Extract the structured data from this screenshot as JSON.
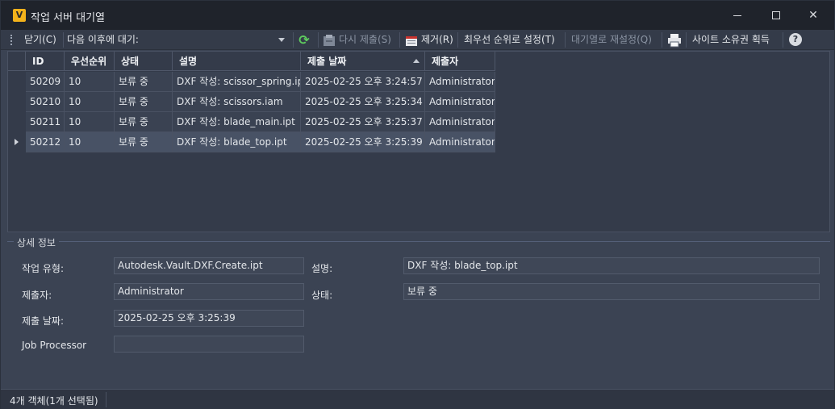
{
  "window": {
    "title": "작업 서버 대기열",
    "icon_letter": "V"
  },
  "toolbar": {
    "close_label": "닫기(C)",
    "wait_label": "다음 이후에 대기:",
    "resubmit_label": "다시 제출(S)",
    "remove_label": "제거(R)",
    "top_priority_label": "최우선 순위로 설정(T)",
    "requeue_label": "대기열로 재설정(Q)",
    "take_ownership_label": "사이트 소유권 획득"
  },
  "grid": {
    "columns": [
      "ID",
      "우선순위",
      "상태",
      "설명",
      "제출 날짜",
      "제출자"
    ],
    "sort_column": "제출 날짜",
    "rows": [
      {
        "id": "50209",
        "priority": "10",
        "status": "보류 중",
        "description": "DXF 작성: scissor_spring.ipt",
        "submitted": "2025-02-25 오후 3:24:57",
        "submitter": "Administrator",
        "selected": false
      },
      {
        "id": "50210",
        "priority": "10",
        "status": "보류 중",
        "description": "DXF 작성: scissors.iam",
        "submitted": "2025-02-25 오후 3:25:34",
        "submitter": "Administrator",
        "selected": false
      },
      {
        "id": "50211",
        "priority": "10",
        "status": "보류 중",
        "description": "DXF 작성: blade_main.ipt",
        "submitted": "2025-02-25 오후 3:25:37",
        "submitter": "Administrator",
        "selected": false
      },
      {
        "id": "50212",
        "priority": "10",
        "status": "보류 중",
        "description": "DXF 작성: blade_top.ipt",
        "submitted": "2025-02-25 오후 3:25:39",
        "submitter": "Administrator",
        "selected": true
      }
    ]
  },
  "details": {
    "title": "상세 정보",
    "job_type_label": "작업 유형:",
    "job_type_value": "Autodesk.Vault.DXF.Create.ipt",
    "submitter_label": "제출자:",
    "submitter_value": "Administrator",
    "date_label": "제출 날짜:",
    "date_value": "2025-02-25 오후 3:25:39",
    "processor_label": "Job Processor",
    "processor_value": "",
    "description_label": "설명:",
    "description_value": "DXF 작성: blade_top.ipt",
    "status_label": "상태:",
    "status_value": "보류 중"
  },
  "statusbar": {
    "text": "4개 객체(1개 선택됨)"
  },
  "colors": {
    "accent": "#f3b21b",
    "refresh_green": "#5ecb5e",
    "background": "#3b4353"
  }
}
